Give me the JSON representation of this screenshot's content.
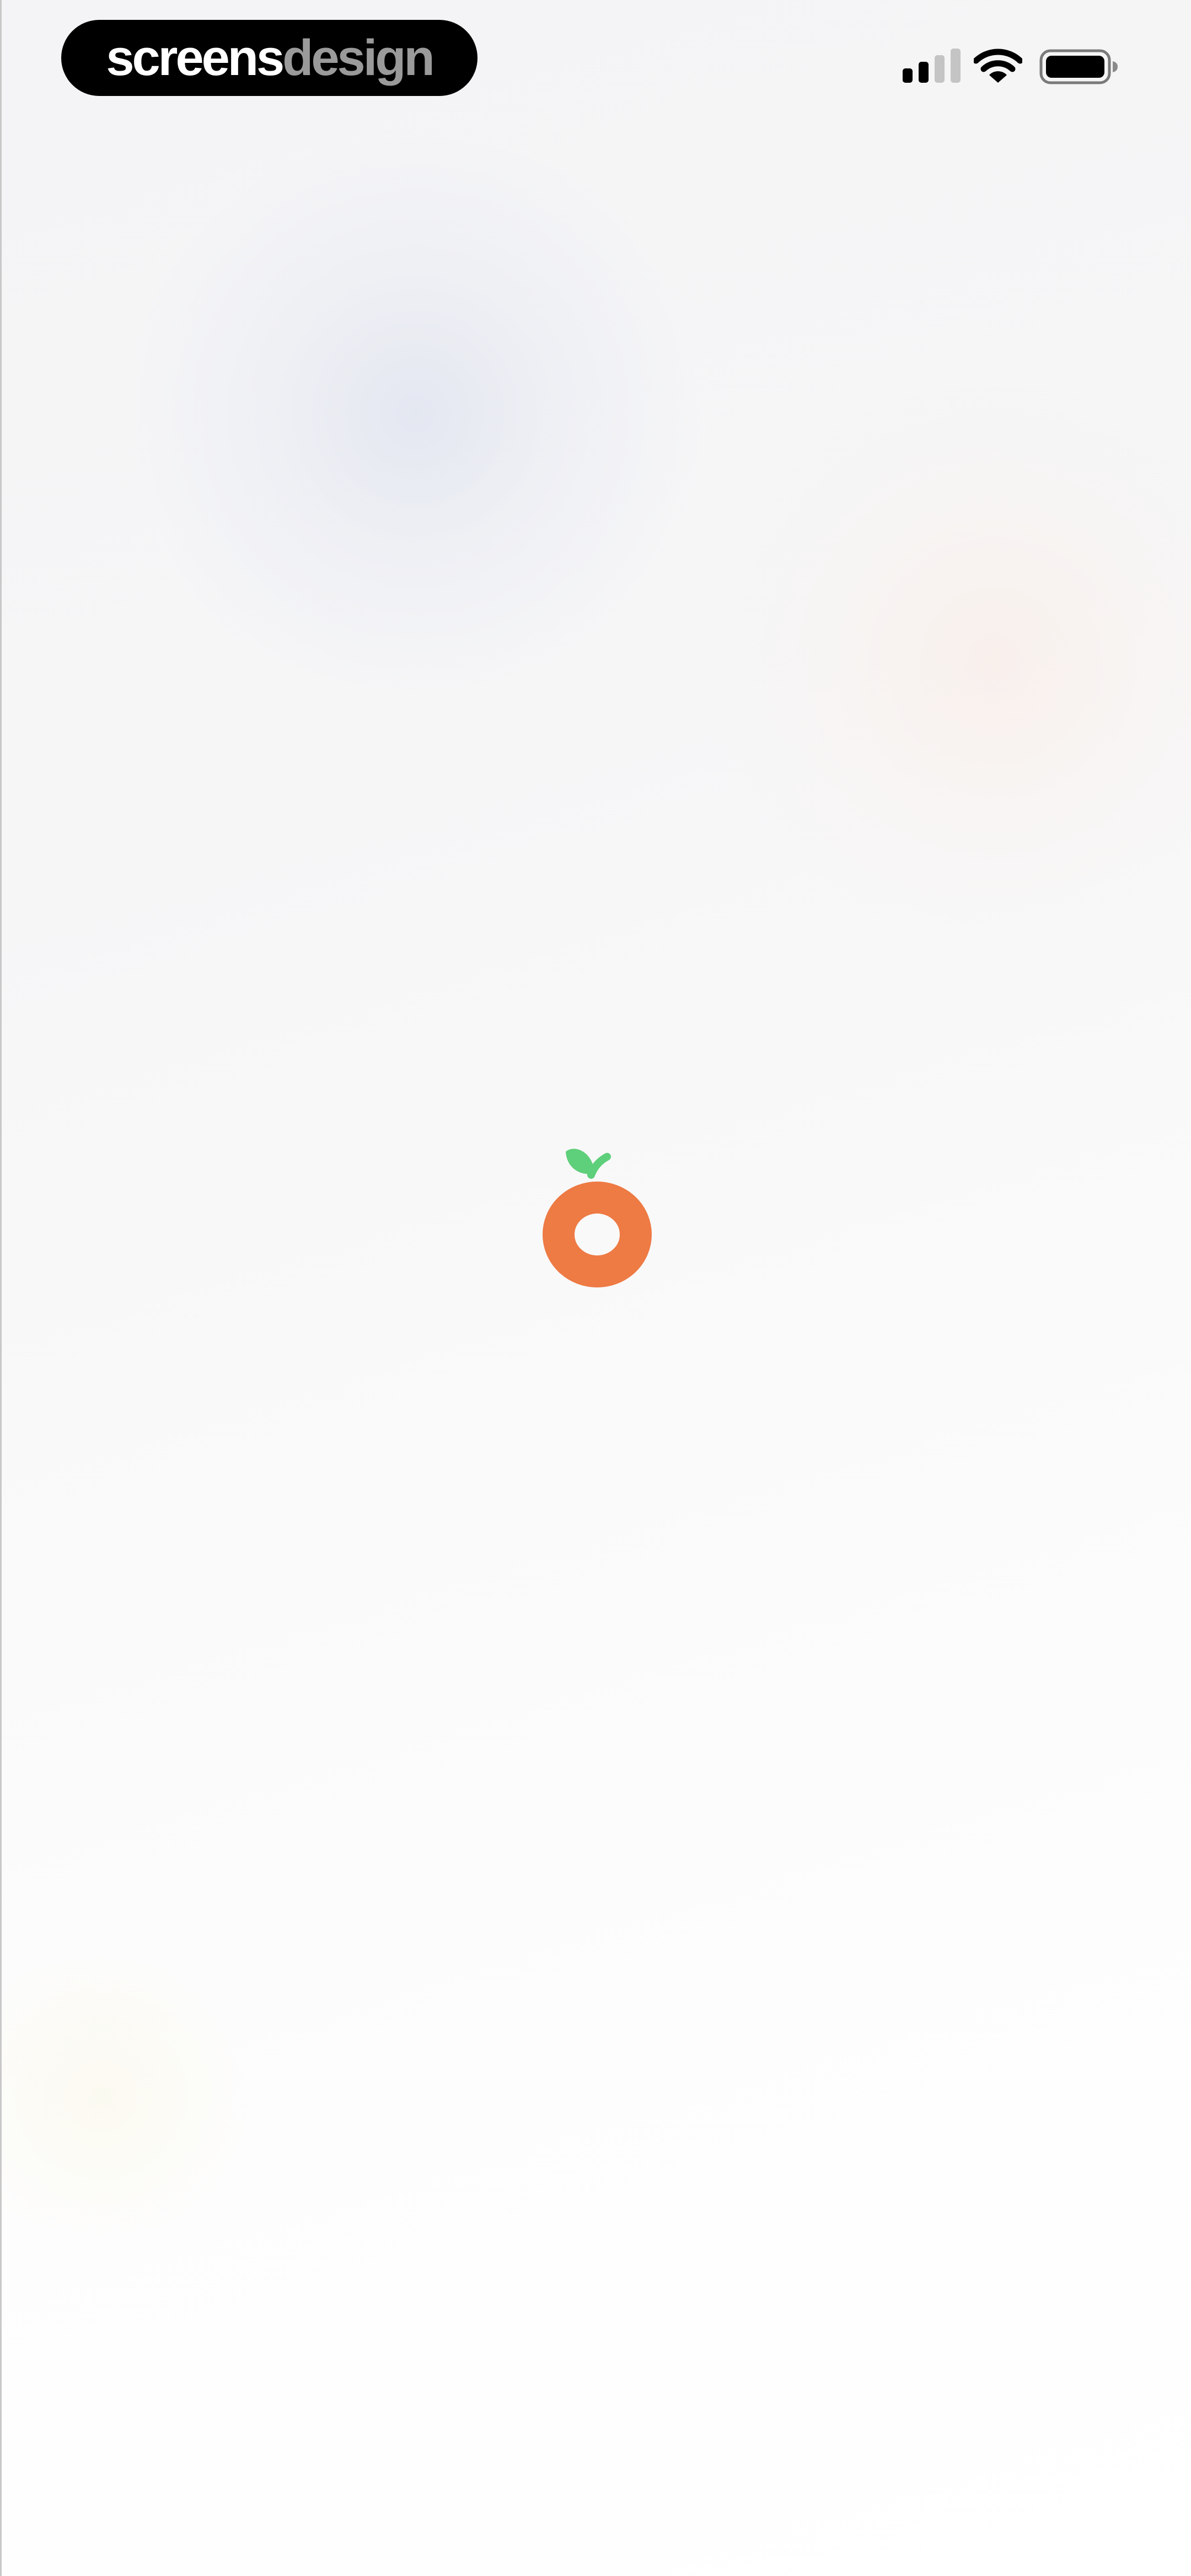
{
  "brand": {
    "part1": "screens",
    "part2": "design"
  },
  "status_bar": {
    "signal_icon": "cellular-signal-icon",
    "signal_bars_active": 2,
    "signal_bars_total": 4,
    "wifi_icon": "wifi-icon",
    "battery_icon": "battery-icon",
    "battery_level": 1.0
  },
  "splash": {
    "logo_icon": "orange-fruit-logo-icon"
  },
  "colors": {
    "logo_orange": "#ee7a44",
    "logo_leaf": "#5ecf7a",
    "pill_background": "#000000",
    "brand_light_text": "#ffffff",
    "brand_gray_text": "#9a9a9a"
  }
}
